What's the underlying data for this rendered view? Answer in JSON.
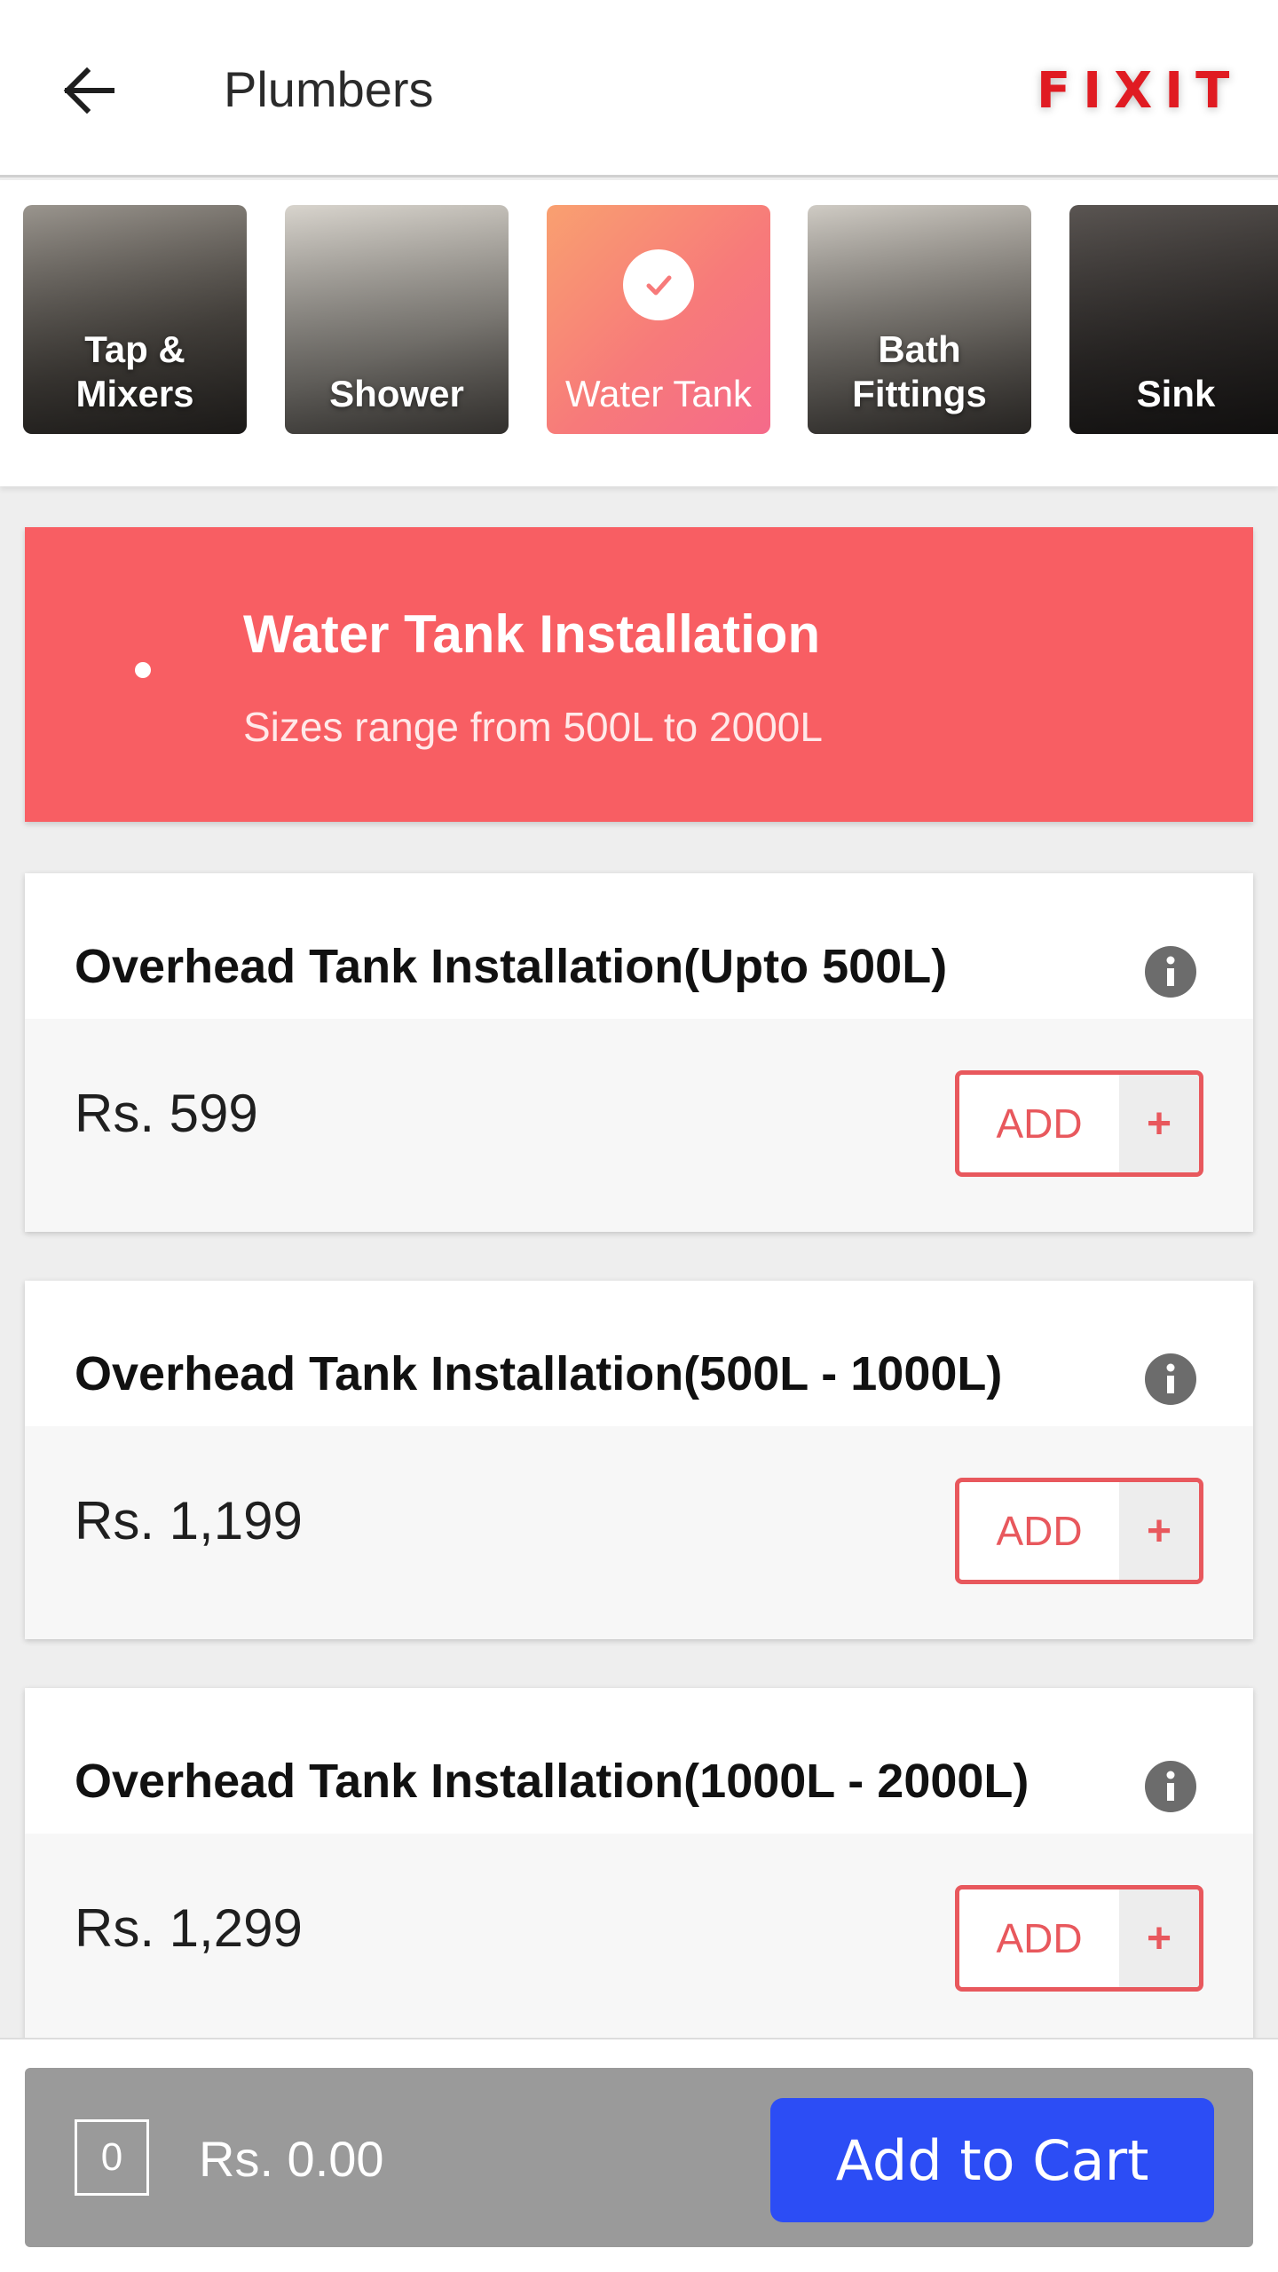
{
  "header": {
    "title": "Plumbers",
    "logo_text": "FIXIT",
    "back_icon": "arrow-left-icon"
  },
  "categories": [
    {
      "label": "Tap &\nMixers",
      "line1": "Tap &",
      "line2": "Mixers",
      "selected": false,
      "bg": "#6b6660"
    },
    {
      "label": "Shower",
      "line1": "Shower",
      "line2": "",
      "selected": false,
      "bg": "#a7a39c"
    },
    {
      "label": "Water Tank",
      "line1": "Water Tank",
      "line2": "",
      "selected": true,
      "bg": "#f77a7a"
    },
    {
      "label": "Bath\nFittings",
      "line1": "Bath",
      "line2": "Fittings",
      "selected": false,
      "bg": "#8d8882"
    },
    {
      "label": "Sink",
      "line1": "Sink",
      "line2": "",
      "selected": false,
      "bg": "#3a3634"
    }
  ],
  "banner": {
    "title": "Water Tank Installation",
    "subtitle": "Sizes range from 500L to 2000L",
    "color": "#f85e63"
  },
  "services": [
    {
      "title": "Overhead Tank Installation(Upto 500L)",
      "price": "Rs. 599",
      "add_label": "ADD",
      "plus_label": "+"
    },
    {
      "title": "Overhead Tank Installation(500L - 1000L)",
      "price": "Rs. 1,199",
      "add_label": "ADD",
      "plus_label": "+"
    },
    {
      "title": "Overhead Tank Installation(1000L - 2000L)",
      "price": "Rs. 1,299",
      "add_label": "ADD",
      "plus_label": "+"
    }
  ],
  "cart": {
    "quantity": "0",
    "total": "Rs. 0.00",
    "button_label": "Add to Cart",
    "button_color": "#2c4df5"
  }
}
